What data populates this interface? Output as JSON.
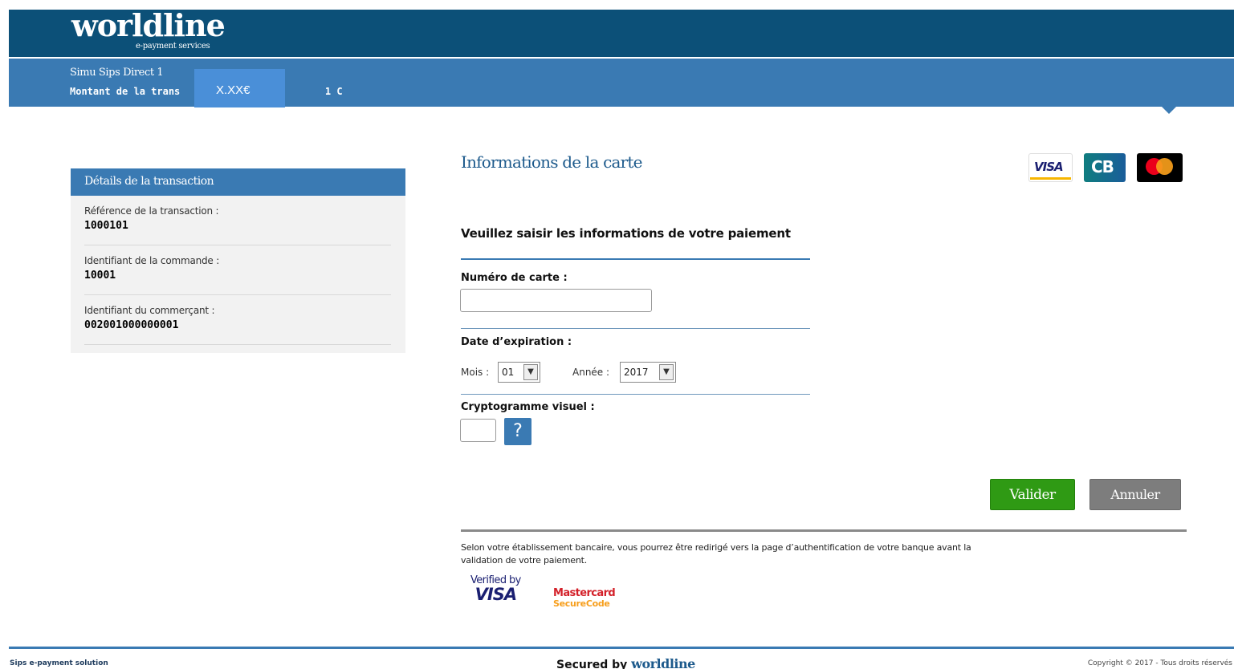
{
  "header": {
    "logo_text": "worldline",
    "logo_tagline": "e-payment services",
    "merchant_name": "Simu Sips Direct 1",
    "amount_label": "Montant de la trans",
    "amount_suffix": "                         1 C",
    "amount_masked": "X.XX€"
  },
  "details": {
    "title": "Détails de la transaction",
    "rows": [
      {
        "label": "Référence de la transaction :",
        "value": "1000101"
      },
      {
        "label": "Identifiant de la commande :",
        "value": "10001"
      },
      {
        "label": "Identifiant du commerçant :",
        "value": "002001000000001"
      }
    ]
  },
  "form": {
    "title": "Informations de la carte",
    "prompt": "Veuillez saisir les informations de votre paiement",
    "card_number_label": "Numéro de carte :",
    "card_number_value": "",
    "expiry_label": "Date d’expiration :",
    "month_label": "Mois :",
    "month_value": "01",
    "year_label": "Année :",
    "year_value": "2017",
    "cvv_label": "Cryptogramme visuel :",
    "cvv_value": "",
    "help_label": "?",
    "submit_label": "Valider",
    "cancel_label": "Annuler"
  },
  "card_logos": {
    "visa": "VISA",
    "cb": "CB",
    "mastercard": "mastercard-logo"
  },
  "security": {
    "notice": "Selon votre établissement bancaire, vous pourrez être redirigé vers la page d’authentification de votre banque avant la validation de votre paiement.",
    "vbv_top": "Verified by",
    "vbv_bottom": "VISA",
    "mc_top": "Mastercard",
    "mc_bottom": "SecureCode"
  },
  "footer": {
    "left": "Sips e-payment solution",
    "center_prefix": "Secured by",
    "center_brand": "worldline",
    "right": "Copyright © 2017 - Tous droits réservés"
  },
  "colors": {
    "header_dark": "#0c5078",
    "header_light": "#3a7ab3",
    "validate_green": "#2f9a14",
    "cancel_grey": "#7d7d7d"
  }
}
